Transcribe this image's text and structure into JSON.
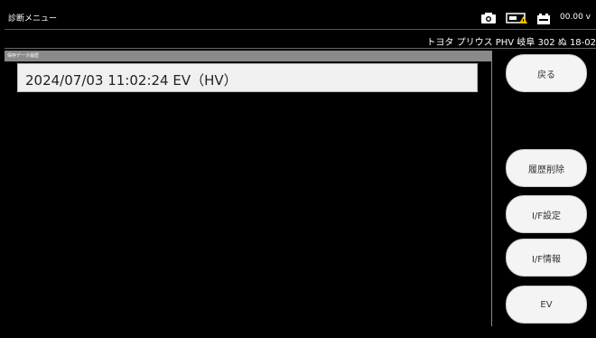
{
  "header": {
    "title": "診断メニュー",
    "voltage": "00.00 v",
    "icons": [
      "camera-icon",
      "connection-warning-icon",
      "battery-icon"
    ],
    "warning_color": "#f5c400"
  },
  "vehicle": {
    "info": "トヨタ プリウス PHV 岐阜 302 ぬ 18-02"
  },
  "list": {
    "header_label": "保存データ履歴",
    "rows": [
      {
        "label": "2024/07/03 11:02:24 EV（HV）"
      }
    ]
  },
  "buttons": {
    "back": "戻る",
    "delete_history": "履歴削除",
    "if_settings": "I/F設定",
    "if_info": "I/F情報",
    "ev": "EV"
  }
}
